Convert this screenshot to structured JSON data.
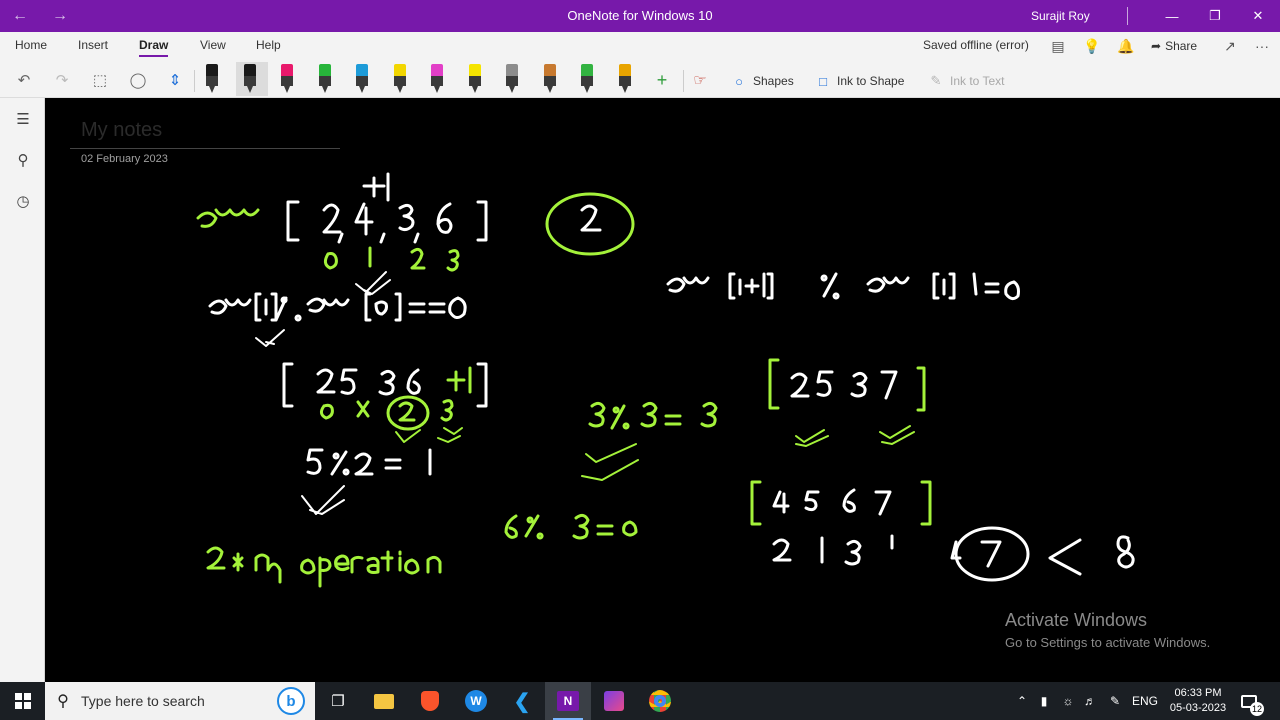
{
  "titlebar": {
    "app_title": "OneNote for Windows 10",
    "user": "Surajit Roy",
    "back_icon": "←",
    "forward_icon": "→",
    "minimize": "—",
    "restore": "❐",
    "close": "✕"
  },
  "ribbon": {
    "tabs": [
      "Home",
      "Insert",
      "Draw",
      "View",
      "Help"
    ],
    "active_tab": "Draw",
    "status": "Saved offline (error)",
    "share_label": "Share",
    "more": "···",
    "tools": {
      "shapes_label": "Shapes",
      "ink_to_shape_label": "Ink to Shape",
      "ink_to_text_label": "Ink to Text"
    },
    "pens": [
      {
        "color": "#1a1a1a"
      },
      {
        "color": "#1a1a1a"
      },
      {
        "color": "#e8196b"
      },
      {
        "color": "#27b53a"
      },
      {
        "color": "#1d9bd8"
      },
      {
        "color": "#f2d600"
      },
      {
        "color": "#e23fc7"
      },
      {
        "color": "#f5e400"
      },
      {
        "color": "#8c8c8c"
      },
      {
        "color": "#c7792f"
      },
      {
        "color": "#32b341"
      },
      {
        "color": "#e8a400"
      }
    ]
  },
  "sidenav": {
    "icons": [
      "notebooks-icon",
      "search-icon",
      "recent-icon"
    ]
  },
  "page": {
    "title": "My notes",
    "date": "02 February 2023"
  },
  "watermark": {
    "title": "Activate Windows",
    "subtitle": "Go to Settings to activate Windows."
  },
  "taskbar": {
    "search_placeholder": "Type here to search",
    "bing_label": "b",
    "lang": "ENG",
    "time": "06:33 PM",
    "date": "05-03-2023",
    "notification_count": "12"
  },
  "colors": {
    "accent": "#7719aa",
    "ink_green": "#a4f23a",
    "ink_white": "#ffffff"
  }
}
